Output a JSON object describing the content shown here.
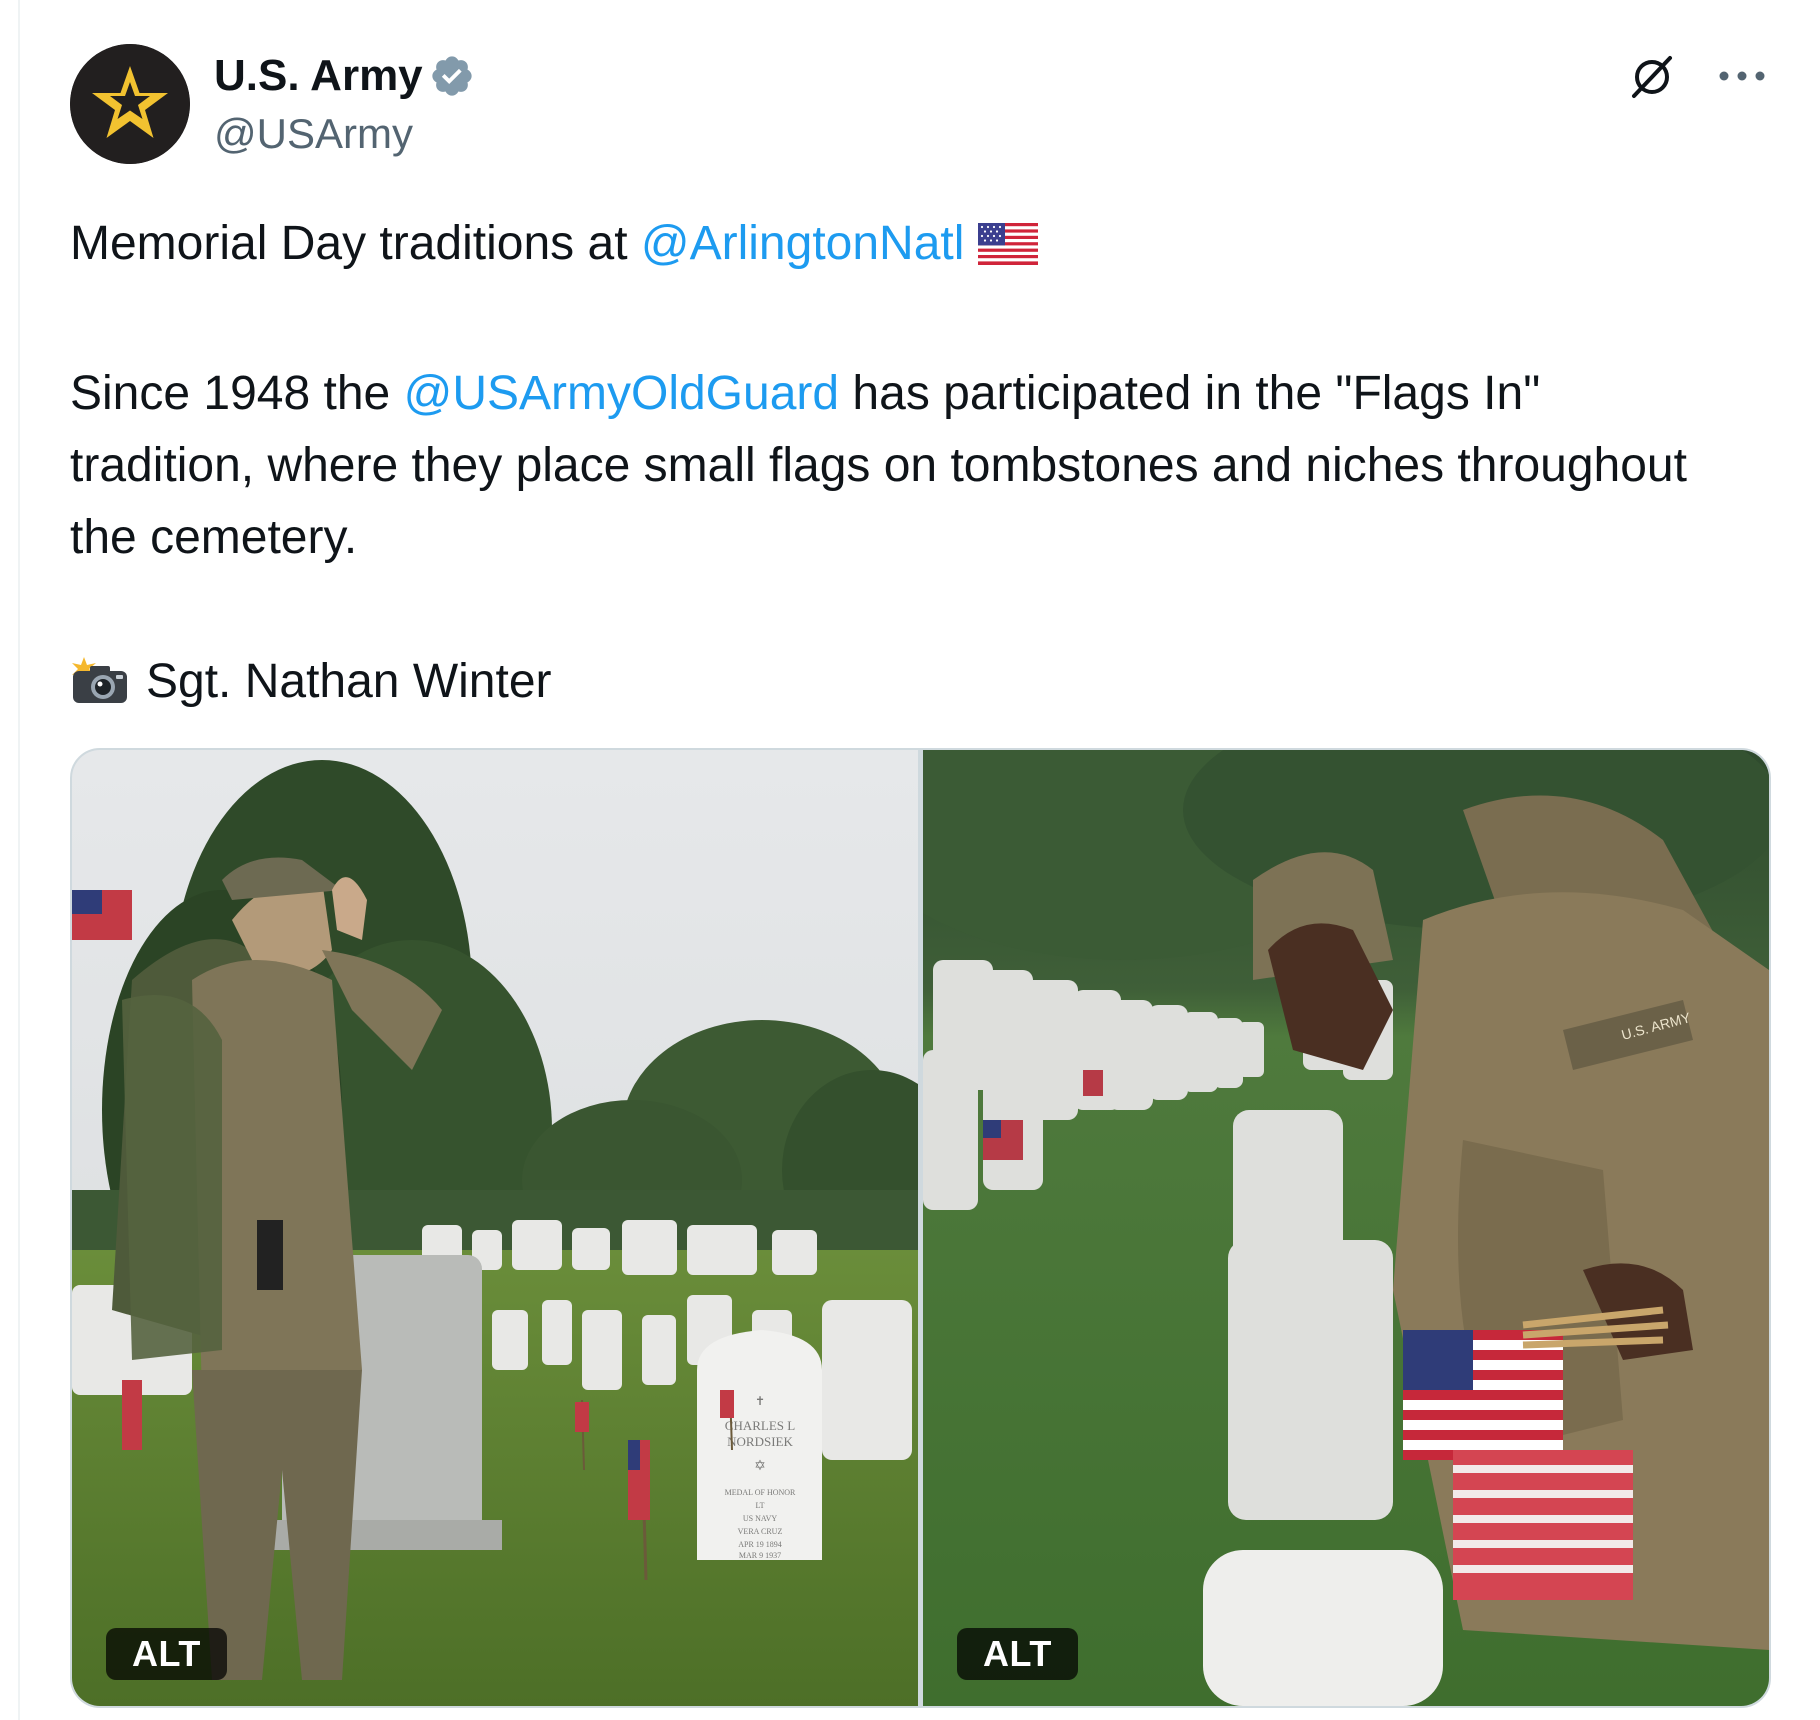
{
  "author": {
    "display_name": "U.S. Army",
    "handle": "@USArmy",
    "verified_icon": "verified-badge-icon",
    "avatar_icon": "army-star-icon"
  },
  "actions": {
    "grok_icon": "grok-icon",
    "more_icon": "more-icon"
  },
  "tweet": {
    "line1_text": "Memorial Day traditions at ",
    "line1_mention": "@ArlingtonNatl",
    "line1_emoji": "us-flag-icon",
    "para2_prefix": "Since 1948 the ",
    "para2_mention": "@USArmyOldGuard",
    "para2_rest": " has participated in the \"Flags In\" tradition, where they place small flags on tombstones and niches throughout the cemetery.",
    "credit_emoji": "camera-flash-icon",
    "credit_text": "Sgt. Nathan Winter"
  },
  "media": {
    "photo1": {
      "alt_label": "ALT",
      "headstone_lines": [
        "CHARLES L",
        "NORDSIEK",
        "MEDAL OF HONOR",
        "LT",
        "US NAVY",
        "VERA CRUZ",
        "APR 19 1894",
        "MAR 9 1937"
      ]
    },
    "photo2": {
      "alt_label": "ALT",
      "name_tape": "U.S. ARMY"
    }
  },
  "colors": {
    "text": "#0f1419",
    "secondary": "#536471",
    "link": "#1d9bf0",
    "border": "#cfd9de",
    "verified": "#829aab"
  }
}
